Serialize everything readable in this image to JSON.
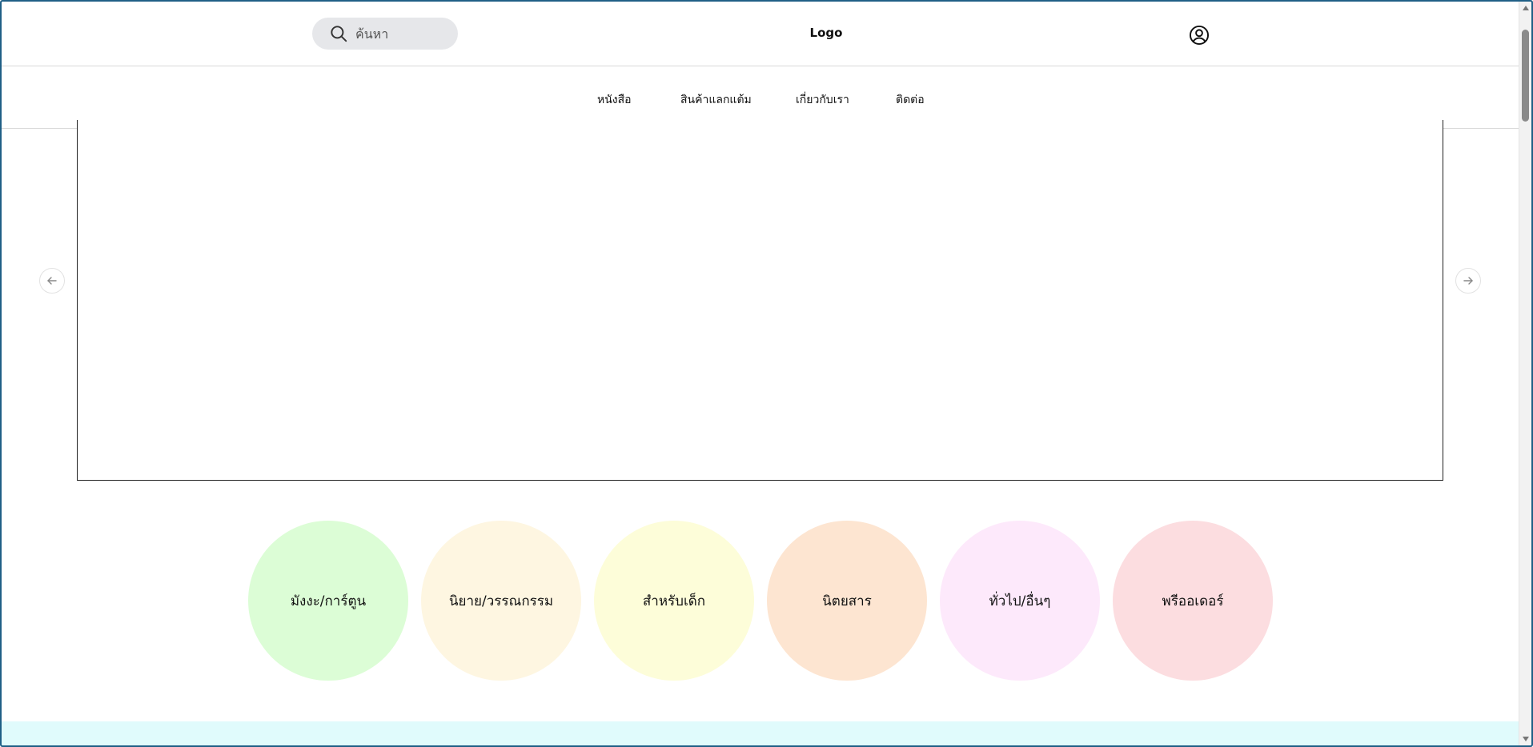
{
  "header": {
    "search_placeholder": "ค้นหา",
    "logo": "Logo"
  },
  "nav": {
    "items": [
      "หนังสือ",
      "สินค้าแลกแต้ม",
      "เกี่ยวกับเรา",
      "ติดต่อ"
    ]
  },
  "carousel": {
    "prev_icon": "arrow-left-icon",
    "next_icon": "arrow-right-icon"
  },
  "categories": [
    {
      "label": "มังงะ/การ์ตูน",
      "color": "#dcfdd6"
    },
    {
      "label": "นิยาย/วรรณกรรม",
      "color": "#fef6e1"
    },
    {
      "label": "สำหรับเด็ก",
      "color": "#fdfdd9"
    },
    {
      "label": "นิตยสาร",
      "color": "#fde5d1"
    },
    {
      "label": "ทั่วไป/อื่นๆ",
      "color": "#fde9fb"
    },
    {
      "label": "พรีออเดอร์",
      "color": "#fcdde0"
    }
  ],
  "colors": {
    "search_bg": "#e6e7ea",
    "footer_strip": "#e0fbfc",
    "window_border": "#1f5f86"
  }
}
